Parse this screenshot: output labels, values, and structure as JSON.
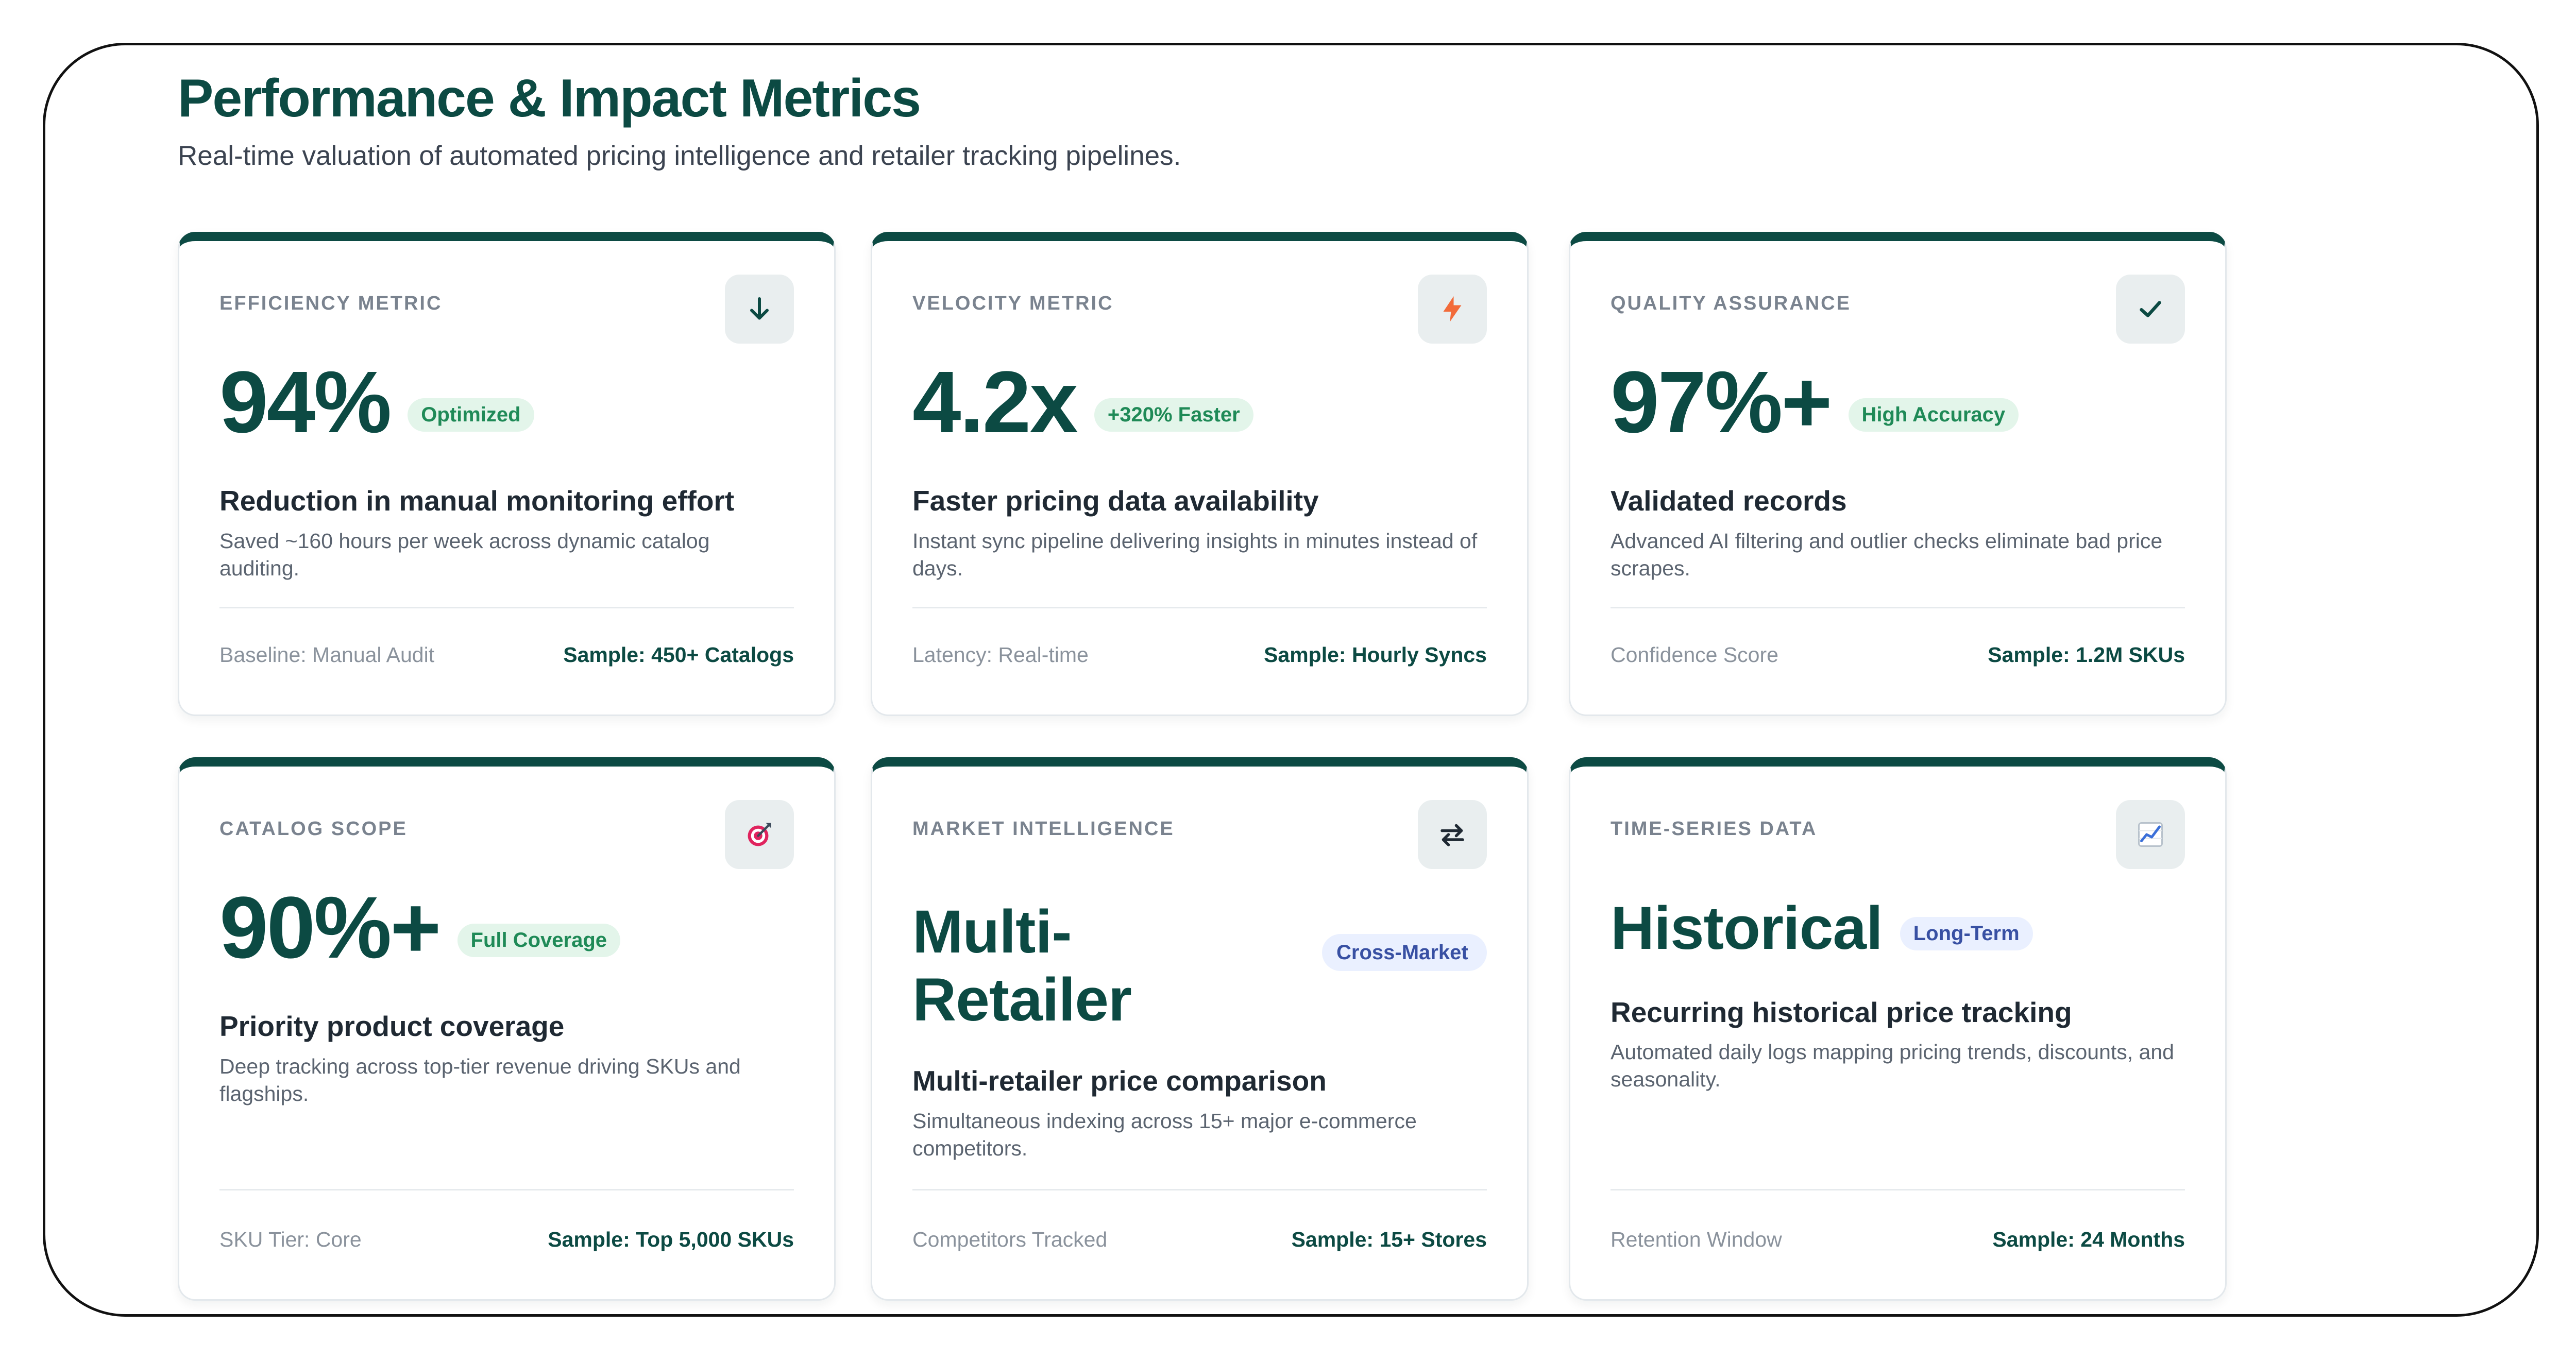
{
  "header": {
    "title": "Performance & Impact Metrics",
    "subtitle": "Real-time valuation of automated pricing intelligence and retailer tracking pipelines."
  },
  "cards": [
    {
      "category": "EFFICIENCY METRIC",
      "icon": "arrow-down-icon",
      "value": "94%",
      "badge": "Optimized",
      "headline": "Reduction in manual monitoring effort",
      "description": "Saved ~160 hours per week across dynamic catalog auditing.",
      "footer_left": "Baseline: Manual Audit",
      "footer_right": "Sample: 450+ Catalogs"
    },
    {
      "category": "VELOCITY METRIC",
      "icon": "lightning-icon",
      "value": "4.2x",
      "badge": "+320% Faster",
      "headline": "Faster pricing data availability",
      "description": "Instant sync pipeline delivering insights in minutes instead of days.",
      "footer_left": "Latency: Real-time",
      "footer_right": "Sample: Hourly Syncs"
    },
    {
      "category": "QUALITY ASSURANCE",
      "icon": "checkmark-icon",
      "value": "97%+",
      "badge": "High Accuracy",
      "headline": "Validated records",
      "description": "Advanced AI filtering and outlier checks eliminate bad price scrapes.",
      "footer_left": "Confidence Score",
      "footer_right": "Sample: 1.2M SKUs"
    },
    {
      "category": "CATALOG SCOPE",
      "icon": "target-icon",
      "value": "90%+",
      "badge": "Full Coverage",
      "headline": "Priority product coverage",
      "description": "Deep tracking across top-tier revenue driving SKUs and flagships.",
      "footer_left": "SKU Tier: Core",
      "footer_right": "Sample: Top 5,000 SKUs"
    },
    {
      "category": "MARKET INTELLIGENCE",
      "icon": "swap-arrows-icon",
      "value_line1": "Multi-",
      "value_line2": "Retailer",
      "badge": "Cross-Market",
      "headline": "Multi-retailer price comparison",
      "description": "Simultaneous indexing across 15+ major e-commerce competitors.",
      "footer_left": "Competitors Tracked",
      "footer_right": "Sample: 15+ Stores"
    },
    {
      "category": "TIME-SERIES DATA",
      "icon": "trend-chart-icon",
      "value": "Historical",
      "badge": "Long-Term",
      "headline": "Recurring historical price tracking",
      "description": "Automated daily logs mapping pricing trends, discounts, and seasonality.",
      "footer_left": "Retention Window",
      "footer_right": "Sample: 24 Months"
    }
  ],
  "colors": {
    "brand_dark_green": "#0c4a43",
    "badge_green_bg": "#e3f5ea",
    "badge_green_text": "#1f8a57",
    "badge_blue_bg": "#eaf0ff",
    "badge_blue_text": "#3850a3",
    "lightning_orange": "#f26b3a",
    "target_red": "#e0245e"
  }
}
